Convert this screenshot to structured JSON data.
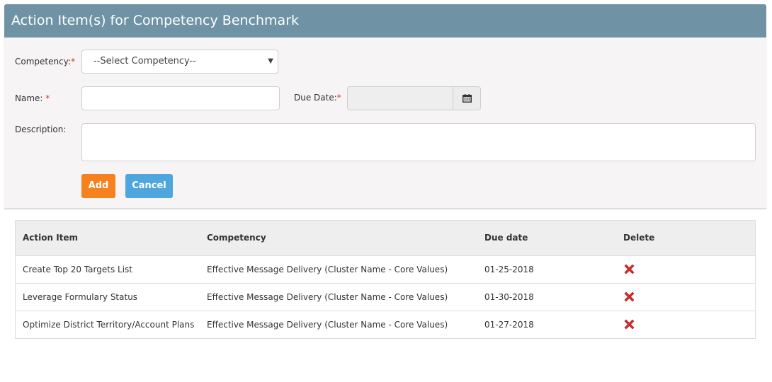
{
  "panel": {
    "title": "Action Item(s) for Competency Benchmark"
  },
  "form": {
    "competency_label": "Competency:",
    "competency_required": "*",
    "competency_value": "--Select Competency--",
    "name_label": "Name:",
    "name_required": "*",
    "name_value": "",
    "due_date_label": "Due Date:",
    "due_date_required": "*",
    "due_date_value": "",
    "description_label": "Description:",
    "description_value": "",
    "add_label": "Add",
    "cancel_label": "Cancel"
  },
  "table": {
    "headers": [
      "Action Item",
      "Competency",
      "Due date",
      "Delete"
    ],
    "rows": [
      {
        "action_item": "Create Top 20 Targets List",
        "competency": "Effective Message Delivery (Cluster Name - Core Values)",
        "due_date": "01-25-2018"
      },
      {
        "action_item": "Leverage Formulary Status",
        "competency": "Effective Message Delivery (Cluster Name - Core Values)",
        "due_date": "01-30-2018"
      },
      {
        "action_item": "Optimize District Territory/Account Plans",
        "competency": "Effective Message Delivery (Cluster Name - Core Values)",
        "due_date": "01-27-2018"
      }
    ]
  },
  "colors": {
    "header_bg": "#6f93a5",
    "add_button": "#f5811f",
    "cancel_button": "#4ea6dd",
    "delete_icon": "#d62b2b",
    "required": "#d9342b"
  },
  "icons": {
    "calendar": "calendar-icon",
    "delete": "delete-x-icon",
    "dropdown": "chevron-down-icon"
  }
}
